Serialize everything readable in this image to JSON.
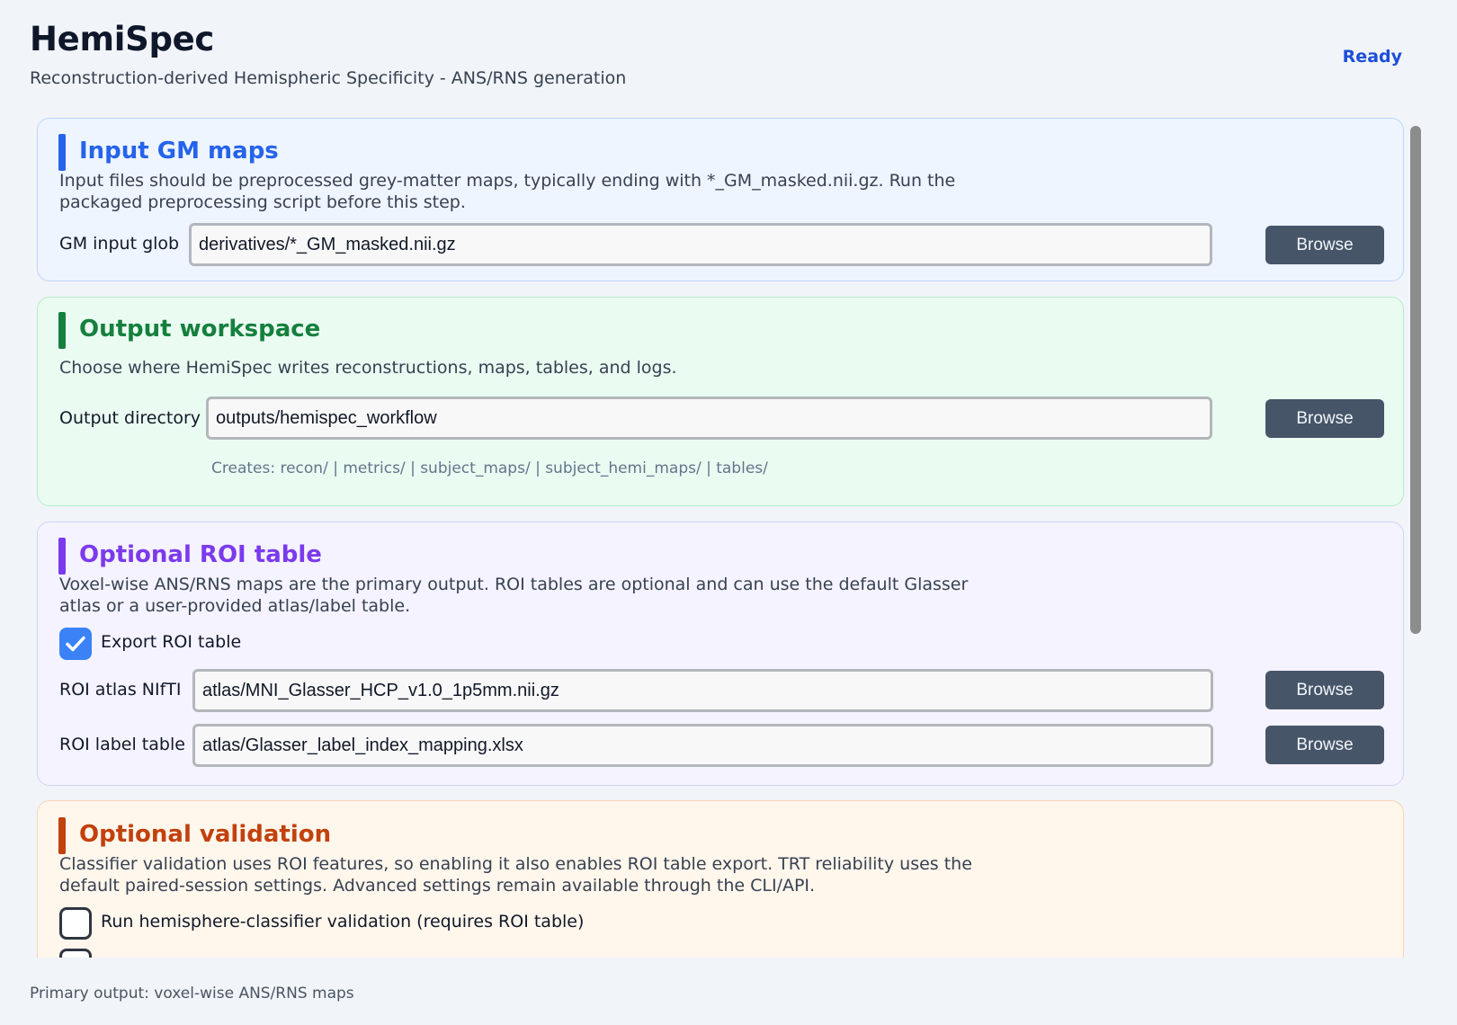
{
  "app": {
    "title": "HemiSpec",
    "subtitle": "Reconstruction-derived Hemispheric Specificity - ANS/RNS generation",
    "status": "Ready"
  },
  "colors": {
    "blue": "#2563eb",
    "green": "#15803d",
    "purple": "#7c3aed",
    "orange": "#c2410c"
  },
  "input_section": {
    "title": "Input GM maps",
    "description": "Input files should be preprocessed grey-matter maps, typically ending with *_GM_masked.nii.gz. Run the packaged preprocessing script before this step.",
    "gm_glob_label": "GM input glob",
    "gm_glob_value": "derivatives/*_GM_masked.nii.gz",
    "browse_label": "Browse"
  },
  "output_section": {
    "title": "Output workspace",
    "description": "Choose where HemiSpec writes reconstructions, maps, tables, and logs.",
    "dir_label": "Output directory",
    "dir_value": "outputs/hemispec_workflow",
    "browse_label": "Browse",
    "creates_hint": "Creates: recon/ | metrics/ | subject_maps/ | subject_hemi_maps/ | tables/"
  },
  "roi_section": {
    "title": "Optional ROI table",
    "description": "Voxel-wise ANS/RNS maps are the primary output. ROI tables are optional and can use the default Glasser atlas or a user-provided atlas/label table.",
    "export_label": "Export ROI table",
    "export_checked": true,
    "atlas_label": "ROI atlas NIfTI",
    "atlas_value": "atlas/MNI_Glasser_HCP_v1.0_1p5mm.nii.gz",
    "table_label": "ROI label table",
    "table_value": "atlas/Glasser_label_index_mapping.xlsx",
    "browse_label": "Browse"
  },
  "validation_section": {
    "title": "Optional validation",
    "description": "Classifier validation uses ROI features, so enabling it also enables ROI table export. TRT reliability uses the default paired-session settings. Advanced settings remain available through the CLI/API.",
    "classifier_label": "Run hemisphere-classifier validation (requires ROI table)",
    "classifier_checked": false
  },
  "footer": {
    "text": "Primary output: voxel-wise ANS/RNS maps"
  }
}
